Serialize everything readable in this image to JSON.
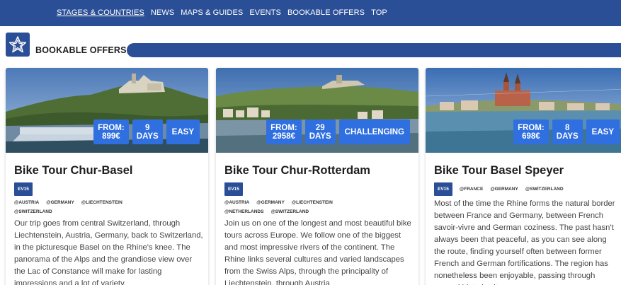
{
  "nav": {
    "items": [
      {
        "label": "STAGES & COUNTRIES",
        "active": true
      },
      {
        "label": "NEWS",
        "active": false
      },
      {
        "label": "MAPS & GUIDES",
        "active": false
      },
      {
        "label": "EVENTS",
        "active": false
      },
      {
        "label": "BOOKABLE OFFERS",
        "active": false
      },
      {
        "label": "TOP",
        "active": false
      }
    ]
  },
  "section": {
    "title": "BOOKABLE OFFERS",
    "icon": "star-icon"
  },
  "cards": [
    {
      "title": "Bike Tour Chur-Basel",
      "route": "EV15",
      "countries": [
        "@AUSTRIA",
        "@GERMANY",
        "@LIECHTENSTEIN",
        "@SWITZERLAND"
      ],
      "price_label": "FROM:",
      "price": "899€",
      "days_num": "9",
      "days_label": "DAYS",
      "difficulty": "EASY",
      "description": "Our trip goes from central Switzerland, through Liechtenstein, Austria, Germany, back to Switzerland, in the picturesque Basel on the Rhine's knee. The panorama of the Alps and the grandiose view over the Lac of Constance will make for lasting impressions and a lot of variety."
    },
    {
      "title": "Bike Tour Chur-Rotterdam",
      "route": "EV15",
      "countries": [
        "@AUSTRIA",
        "@GERMANY",
        "@LIECHTENSTEIN",
        "@NETHERLANDS",
        "@SWITZERLAND"
      ],
      "price_label": "FROM:",
      "price": "2958€",
      "days_num": "29",
      "days_label": "DAYS",
      "difficulty": "CHALLENGING",
      "description": "Join us on one of the longest and most beautiful bike tours across Europe. We follow one of the biggest and most impressive rivers of the continent. The Rhine links several cultures and varied landscapes from the Swiss Alps, through the principality of Liechtenstein, through Austria"
    },
    {
      "title": "Bike Tour Basel Speyer",
      "route": "EV15",
      "countries": [
        "@FRANCE",
        "@GERMANY",
        "@SWITZERLAND"
      ],
      "price_label": "FROM:",
      "price": "698€",
      "days_num": "8",
      "days_label": "DAYS",
      "difficulty": "EASY",
      "description": "Most of the time the Rhine forms the natural border between France and Germany, between French savoir-vivre and German coziness. The past hasn't always been that peaceful, as you can see along the route, finding yourself often between former French and German fortifications. The region has nonetheless been enjoyable, passing through several historic sites"
    }
  ]
}
